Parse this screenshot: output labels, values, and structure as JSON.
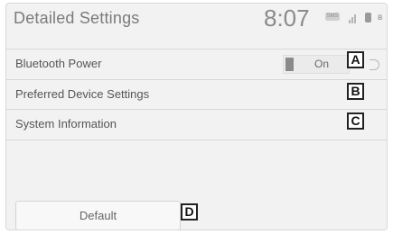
{
  "header": {
    "title": "Detailed Settings",
    "time": "8:07"
  },
  "status": {
    "sms_label": "SMS",
    "signal_icon": "signal-icon",
    "phone_icon": "phone-icon",
    "bluetooth_icon": "bluetooth-icon"
  },
  "settings": [
    {
      "label": "Bluetooth Power",
      "callout": "A"
    },
    {
      "label": "Preferred Device Settings",
      "callout": "B"
    },
    {
      "label": "System Information",
      "callout": "C"
    }
  ],
  "bluetooth_toggle": {
    "state": "On"
  },
  "default_button": {
    "label": "Default",
    "callout": "D"
  }
}
